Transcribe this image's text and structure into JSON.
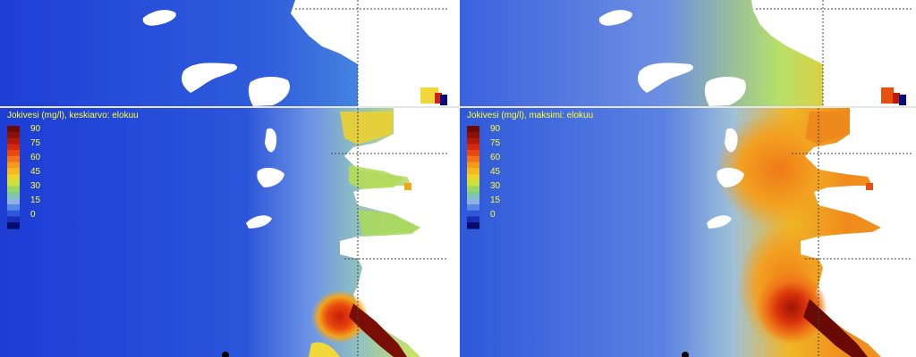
{
  "panels": [
    {
      "title": "Jokivesi (mg/l), keskiarvo: elokuu"
    },
    {
      "title": "Jokivesi (mg/l), maksimi: elokuu"
    }
  ],
  "legend": {
    "labels": [
      "90",
      "75",
      "60",
      "45",
      "30",
      "15",
      "0"
    ],
    "colors": [
      "#6b0a04",
      "#8a1205",
      "#b01a08",
      "#d22a0a",
      "#ea4a10",
      "#f2731a",
      "#f5981e",
      "#f6b81f",
      "#eed42a",
      "#c8e040",
      "#96d662",
      "#7fc7a8",
      "#8fb3e0",
      "#5a86e6",
      "#2e57dc",
      "#1a2fb8",
      "#0a0a6a"
    ]
  },
  "colors": {
    "water_low": "#1f40d8",
    "water_mid": "#4f78e0",
    "land": "#ffffff",
    "grid_line": "#555555"
  }
}
